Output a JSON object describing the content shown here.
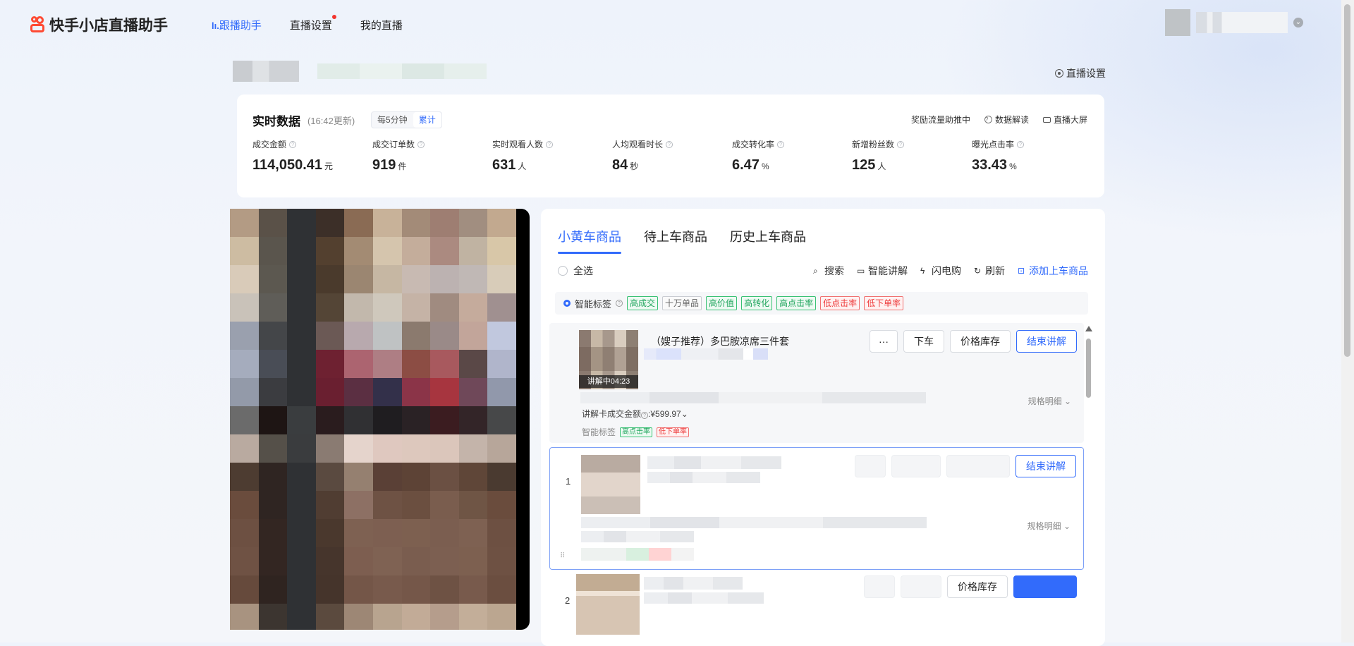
{
  "app": {
    "title": "快手小店直播助手"
  },
  "nav": {
    "items": [
      {
        "label": "跟播助手",
        "active": true,
        "icon": "chart-bars-icon"
      },
      {
        "label": "直播设置",
        "active": false,
        "dot": true
      },
      {
        "label": "我的直播",
        "active": false
      }
    ]
  },
  "header": {
    "live_settings": "直播设置"
  },
  "stats": {
    "title": "实时数据",
    "updated": "(16:42更新)",
    "seg_left": "每5分钟",
    "seg_right": "累计",
    "links": {
      "traffic": "奖励流量助推中",
      "explain": "数据解读",
      "bigscreen": "直播大屏"
    },
    "metrics": [
      {
        "label": "成交金额",
        "value": "114,050.41",
        "unit": "元"
      },
      {
        "label": "成交订单数",
        "value": "919",
        "unit": "件"
      },
      {
        "label": "实时观看人数",
        "value": "631",
        "unit": "人"
      },
      {
        "label": "人均观看时长",
        "value": "84",
        "unit": "秒"
      },
      {
        "label": "成交转化率",
        "value": "6.47",
        "unit": "%"
      },
      {
        "label": "新增粉丝数",
        "value": "125",
        "unit": "人"
      },
      {
        "label": "曝光点击率",
        "value": "33.43",
        "unit": "%"
      }
    ]
  },
  "products": {
    "tabs": [
      "小黄车商品",
      "待上车商品",
      "历史上车商品"
    ],
    "select_all": "全选",
    "actions": {
      "search": "搜索",
      "smart_explain": "智能讲解",
      "flash": "闪电购",
      "refresh": "刷新",
      "add": "添加上车商品"
    },
    "smart_label": "智能标签",
    "filter_tags": [
      {
        "text": "高成交",
        "tone": "g"
      },
      {
        "text": "十万单品",
        "tone": "gray"
      },
      {
        "text": "高价值",
        "tone": "g"
      },
      {
        "text": "高转化",
        "tone": "g"
      },
      {
        "text": "高点击率",
        "tone": "g"
      },
      {
        "text": "低点击率",
        "tone": "r"
      },
      {
        "text": "低下单率",
        "tone": "r"
      }
    ],
    "item1": {
      "title": "（嫂子推荐）多巴胺凉席三件套",
      "badge": "讲解中04:23",
      "btn_more": "···",
      "btn_offshelf": "下车",
      "btn_price": "价格库存",
      "btn_end": "结束讲解",
      "spec": "规格明细",
      "amount_label": "讲解卡成交金额",
      "amount_value": ":¥599.97",
      "smart": "智能标签",
      "tags": [
        {
          "text": "高点击率",
          "tone": "g"
        },
        {
          "text": "低下单率",
          "tone": "r"
        }
      ]
    },
    "item2": {
      "index": "1",
      "btn_end": "结束讲解",
      "spec": "规格明细"
    },
    "item3": {
      "index": "2",
      "btn_price": "价格库存"
    }
  }
}
